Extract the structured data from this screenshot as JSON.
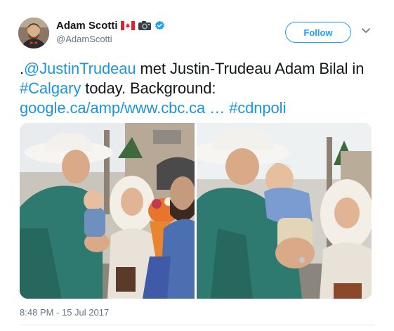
{
  "author": {
    "display_name": "Adam Scotti",
    "handle": "@AdamScotti",
    "badges": [
      "canada-flag-icon",
      "camera-icon",
      "verified-badge-icon"
    ]
  },
  "actions": {
    "follow_label": "Follow",
    "menu_icon": "chevron-down-icon"
  },
  "tweet": {
    "prefix": ".",
    "mention": "@JustinTrudeau",
    "text_mid": " met Justin-Trudeau Adam Bilal in ",
    "hashtag_location": "#Calgary",
    "text_end": " today. Background: ",
    "link": "google.ca/amp/www.cbc.ca …",
    "hashtag_topic": "#cdnpoli"
  },
  "media": {
    "photo_count": 2,
    "photos": [
      {
        "label": "Man in white cowboy hat shaking hands with family holding flowers"
      },
      {
        "label": "Man in white cowboy hat holding a baby next to woman in hijab"
      }
    ]
  },
  "timestamp": "8:48 PM - 15 Jul 2017",
  "colors": {
    "accent": "#1da1f2",
    "link": "#1b95e0",
    "muted": "#657786"
  }
}
